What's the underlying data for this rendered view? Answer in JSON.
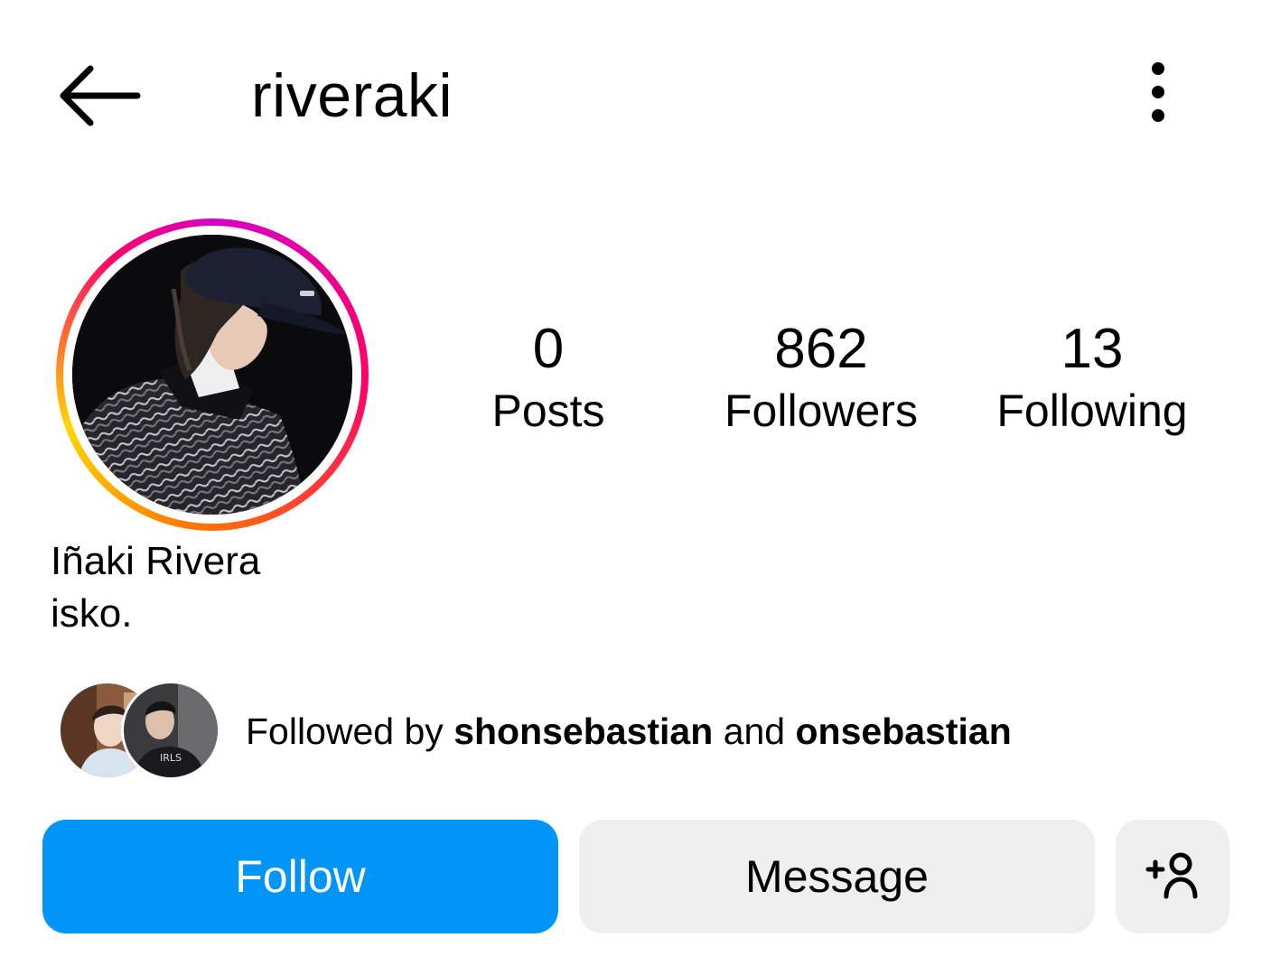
{
  "header": {
    "back_icon": "arrow-left-icon",
    "username": "riveraki",
    "more_icon": "more-vertical-icon"
  },
  "profile": {
    "avatar_ring_colors": [
      "#d300c5",
      "#ff0069",
      "#ff7a00",
      "#ffd600"
    ],
    "full_name": "Iñaki Rivera",
    "bio": "isko."
  },
  "stats": {
    "posts": {
      "value": "0",
      "label": "Posts"
    },
    "followers": {
      "value": "862",
      "label": "Followers"
    },
    "following": {
      "value": "13",
      "label": "Following"
    }
  },
  "mutual": {
    "prefix": "Followed by",
    "user1": "shonsebastian",
    "conjunction": "and",
    "user2": "onsebastian"
  },
  "actions": {
    "follow_label": "Follow",
    "message_label": "Message",
    "suggest_icon": "add-person-icon"
  },
  "colors": {
    "follow_button": "#0095f6",
    "secondary_button": "#efefef",
    "text": "#000000"
  }
}
